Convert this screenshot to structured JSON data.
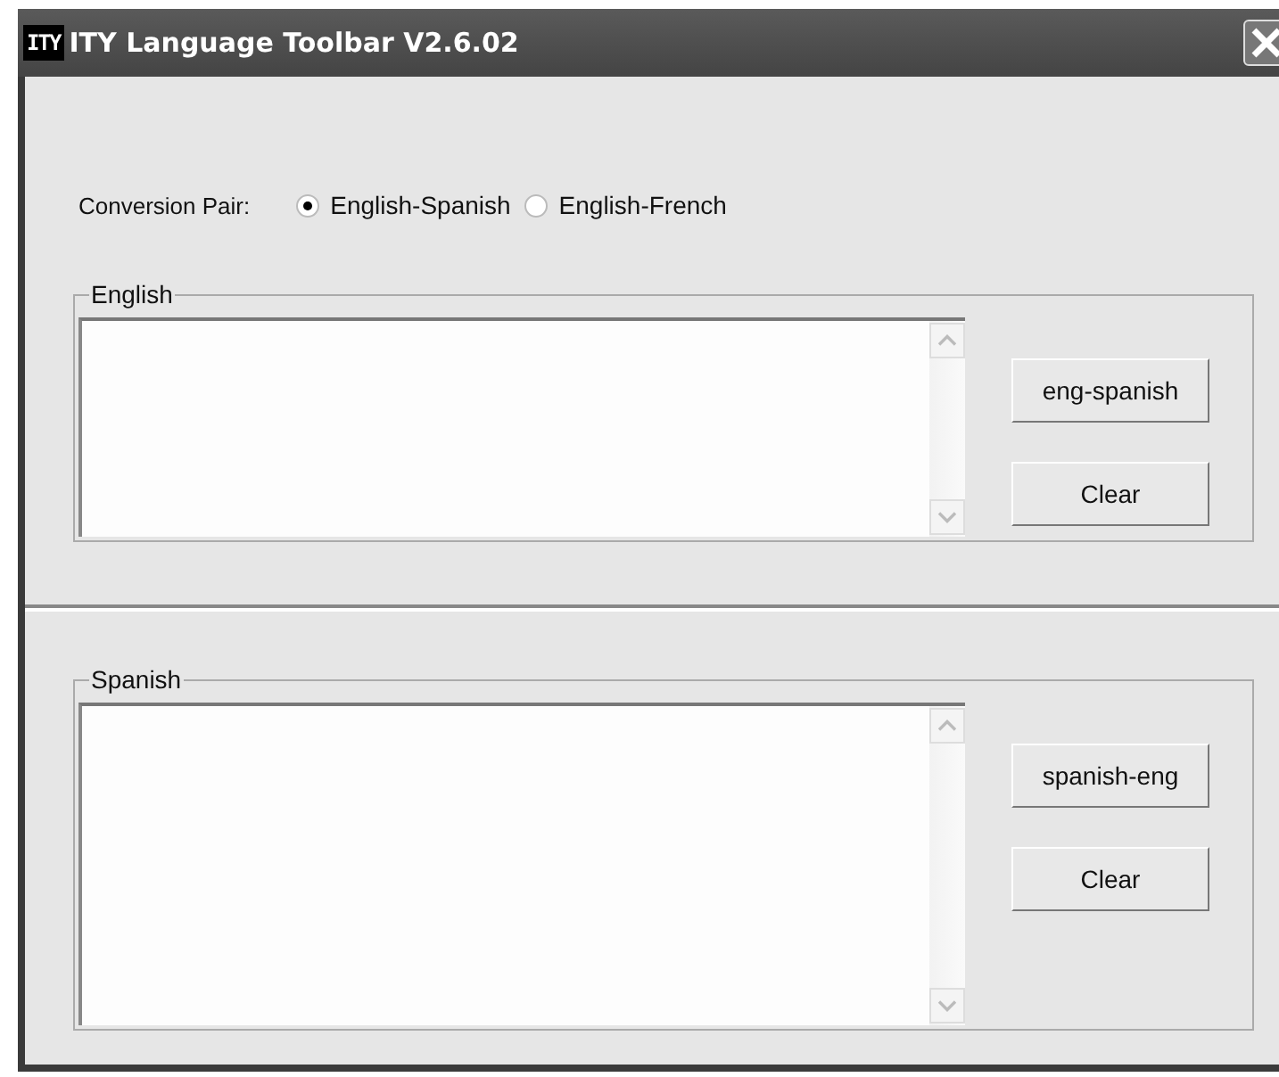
{
  "window": {
    "logo": "ITY",
    "title": "ITY Language Toolbar V2.6.02"
  },
  "conversion_pair": {
    "label": "Conversion Pair:",
    "options": [
      {
        "label": "English-Spanish",
        "selected": true
      },
      {
        "label": "English-French",
        "selected": false
      }
    ]
  },
  "sections": [
    {
      "title": "English",
      "buttons": [
        "eng-spanish",
        "Clear"
      ]
    },
    {
      "title": "Spanish",
      "buttons": [
        "spanish-eng",
        "Clear"
      ]
    }
  ]
}
